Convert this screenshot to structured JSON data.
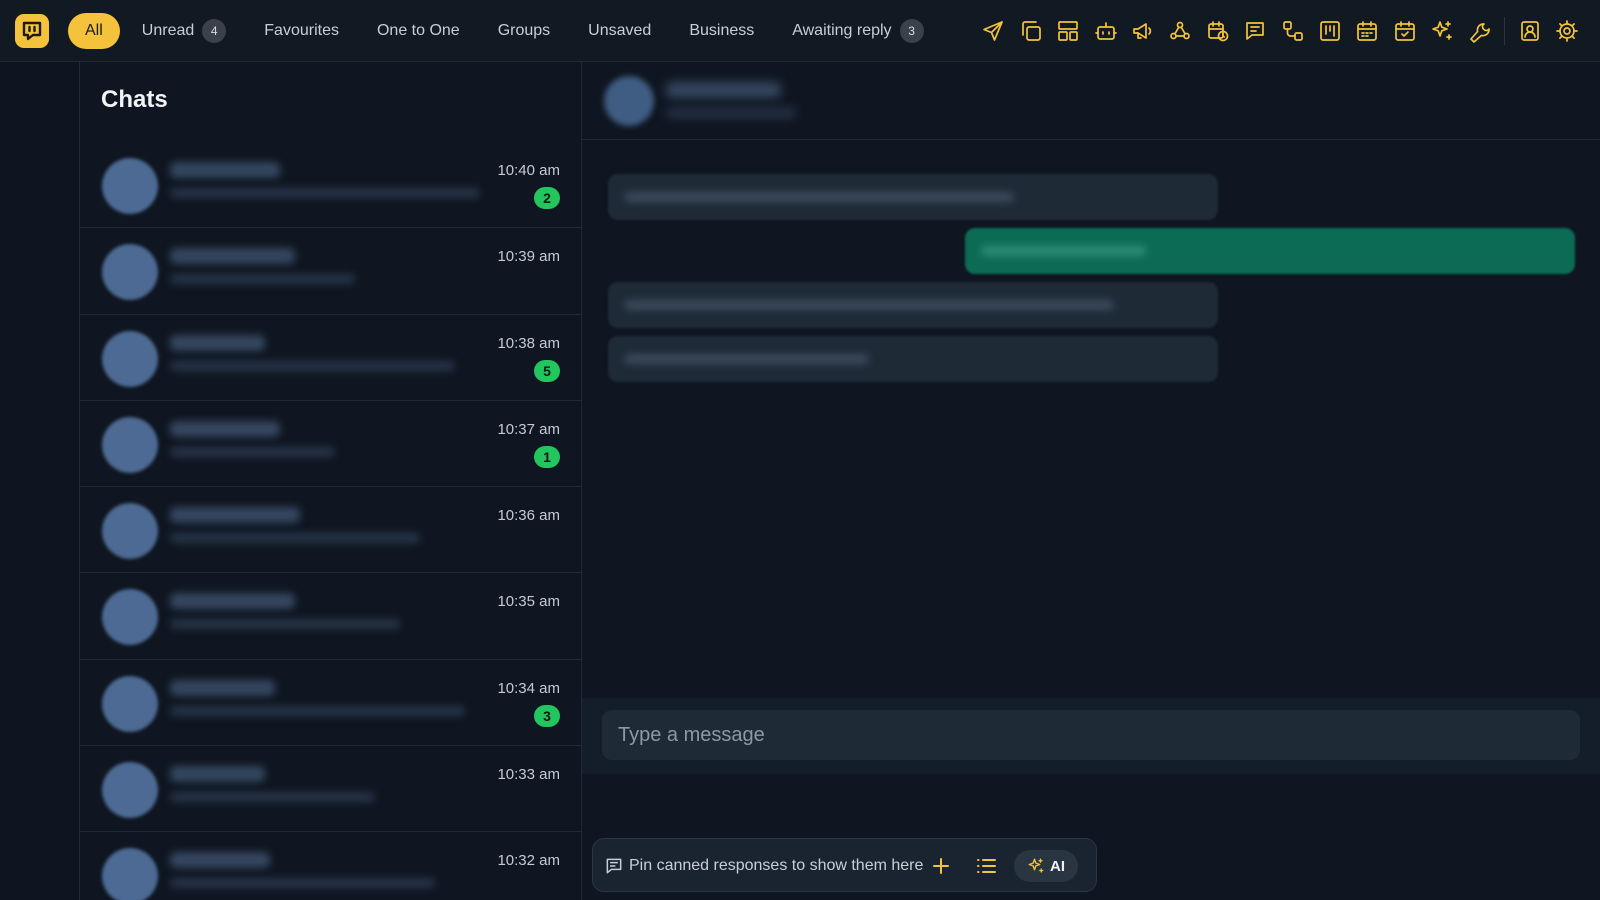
{
  "colors": {
    "accent": "#f5c33b",
    "background": "#0f1621",
    "unread_badge": "#22c55e",
    "outgoing_bubble": "#0c6b55",
    "incoming_bubble": "#1f2a37"
  },
  "header": {
    "logo_icon": "chat-bubble-logo-icon",
    "filters": [
      {
        "label": "All",
        "active": true
      },
      {
        "label": "Unread",
        "count": "4"
      },
      {
        "label": "Favourites"
      },
      {
        "label": "One to One"
      },
      {
        "label": "Groups"
      },
      {
        "label": "Unsaved"
      },
      {
        "label": "Business"
      },
      {
        "label": "Awaiting reply",
        "count": "3"
      }
    ],
    "tools": [
      "send-icon",
      "copy-icon",
      "layout-icon",
      "bot-icon",
      "megaphone-icon",
      "webhook-icon",
      "schedule-icon",
      "message-square-icon",
      "workflow-icon",
      "kanban-icon",
      "calendar-icon",
      "calendar-check-icon",
      "sparkles-icon",
      "wrench-icon",
      "contact-icon",
      "settings-icon"
    ]
  },
  "chats": {
    "title": "Chats",
    "items": [
      {
        "time": "10:40 am",
        "unread": "2"
      },
      {
        "time": "10:39 am"
      },
      {
        "time": "10:38 am",
        "unread": "5"
      },
      {
        "time": "10:37 am",
        "unread": "1"
      },
      {
        "time": "10:36 am"
      },
      {
        "time": "10:35 am"
      },
      {
        "time": "10:34 am",
        "unread": "3"
      },
      {
        "time": "10:33 am"
      },
      {
        "time": "10:32 am"
      }
    ]
  },
  "conversation": {
    "messages": [
      {
        "direction": "incoming"
      },
      {
        "direction": "outgoing"
      },
      {
        "direction": "incoming"
      },
      {
        "direction": "incoming"
      }
    ],
    "compose": {
      "placeholder": "Type a message"
    },
    "canned": {
      "icon": "message-square-icon",
      "text": "Pin canned responses to show them here",
      "add_icon": "plus-icon",
      "list_icon": "list-icon",
      "ai_icon": "sparkles-icon",
      "ai_label": "AI"
    }
  }
}
